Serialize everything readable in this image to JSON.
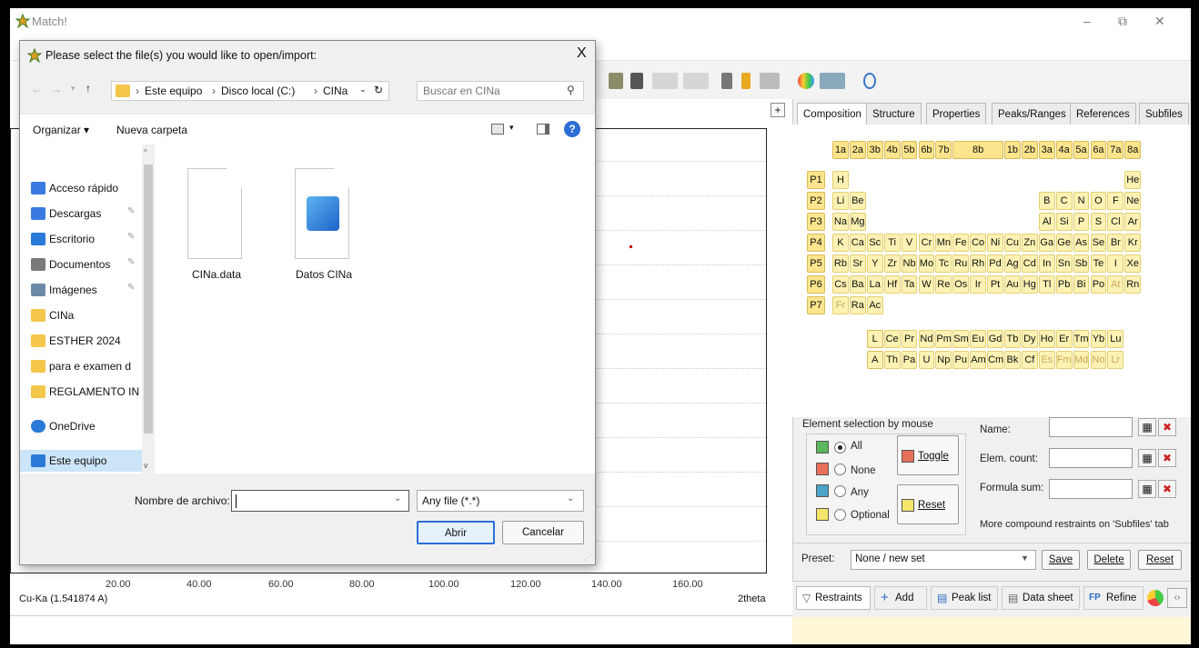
{
  "app": {
    "title": "Match!",
    "window_controls": [
      "–",
      "⧉",
      "✕"
    ]
  },
  "toolbar_icons": [
    "tool-icon",
    "stop-icon",
    "undo-icon",
    "redo-icon",
    "database-icon",
    "book-icon",
    "settings-icon",
    "color-icon",
    "chart-icon",
    "zoom-icon"
  ],
  "plot": {
    "x_ticks": [
      "20.00",
      "40.00",
      "60.00",
      "80.00",
      "100.00",
      "120.00",
      "140.00",
      "160.00"
    ],
    "wavelength_label": "Cu-Ka (1.541874 A)",
    "x_axis_label": "2theta",
    "plus_label": "+"
  },
  "right_panel": {
    "tabs": [
      "Composition",
      "Structure",
      "Properties",
      "Peaks/Ranges",
      "References",
      "Subfiles"
    ],
    "groups": [
      "1a",
      "2a",
      "3b",
      "4b",
      "5b",
      "6b",
      "7b",
      "8b",
      "1b",
      "2b",
      "3a",
      "4a",
      "5a",
      "6a",
      "7a",
      "8a"
    ],
    "periods": [
      "P1",
      "P2",
      "P3",
      "P4",
      "P5",
      "P6",
      "P7"
    ],
    "rows": [
      [
        "H",
        "",
        "",
        "",
        "",
        "",
        "",
        "",
        "",
        "",
        "",
        "",
        "",
        "",
        "",
        "",
        "",
        "He"
      ],
      [
        "Li",
        "Be",
        "",
        "",
        "",
        "",
        "",
        "",
        "",
        "",
        "",
        "",
        "B",
        "C",
        "N",
        "O",
        "F",
        "Ne"
      ],
      [
        "Na",
        "Mg",
        "",
        "",
        "",
        "",
        "",
        "",
        "",
        "",
        "",
        "",
        "Al",
        "Si",
        "P",
        "S",
        "Cl",
        "Ar"
      ],
      [
        "K",
        "Ca",
        "Sc",
        "Ti",
        "V",
        "Cr",
        "Mn",
        "Fe",
        "Co",
        "Ni",
        "Cu",
        "Zn",
        "Ga",
        "Ge",
        "As",
        "Se",
        "Br",
        "Kr"
      ],
      [
        "Rb",
        "Sr",
        "Y",
        "Zr",
        "Nb",
        "Mo",
        "Tc",
        "Ru",
        "Rh",
        "Pd",
        "Ag",
        "Cd",
        "In",
        "Sn",
        "Sb",
        "Te",
        "I",
        "Xe"
      ],
      [
        "Cs",
        "Ba",
        "La",
        "Hf",
        "Ta",
        "W",
        "Re",
        "Os",
        "Ir",
        "Pt",
        "Au",
        "Hg",
        "Tl",
        "Pb",
        "Bi",
        "Po",
        "At",
        "Rn"
      ],
      [
        "Fr",
        "Ra",
        "Ac",
        "",
        "",
        "",
        "",
        "",
        "",
        "",
        "",
        "",
        "",
        "",
        "",
        "",
        "",
        ""
      ]
    ],
    "dim_elements": [
      "At",
      "Fr",
      "Es",
      "Fm",
      "Md",
      "No",
      "Lr"
    ],
    "lanthanide_label": "L",
    "actinide_label": "A",
    "lanthanides": [
      "Ce",
      "Pr",
      "Nd",
      "Pm",
      "Sm",
      "Eu",
      "Gd",
      "Tb",
      "Dy",
      "Ho",
      "Er",
      "Tm",
      "Yb",
      "Lu"
    ],
    "actinides": [
      "Th",
      "Pa",
      "U",
      "Np",
      "Pu",
      "Am",
      "Cm",
      "Bk",
      "Cf",
      "Es",
      "Fm",
      "Md",
      "No",
      "Lr"
    ],
    "selection": {
      "heading": "Element selection by mouse",
      "options": [
        {
          "label": "All",
          "color": "#5cb85c",
          "checked": true
        },
        {
          "label": "None",
          "color": "#e8705a",
          "checked": false
        },
        {
          "label": "Any",
          "color": "#4aa3c8",
          "checked": false
        },
        {
          "label": "Optional",
          "color": "#f5e66a",
          "checked": false
        }
      ],
      "toggle_label": "Toggle",
      "reset_label": "Reset"
    },
    "fields": {
      "name_label": "Name:",
      "count_label": "Elem. count:",
      "formula_label": "Formula sum:"
    },
    "more_text": "More compound restraints on 'Subfiles' tab",
    "preset": {
      "label": "Preset:",
      "value": "None / new set",
      "save": "Save",
      "delete": "Delete",
      "reset": "Reset"
    },
    "bottom_tabs": [
      "Restraints",
      "Add",
      "Peak list",
      "Data sheet",
      "Refine"
    ]
  },
  "dialog": {
    "title": "Please select the file(s) you would like to open/import:",
    "close": "X",
    "breadcrumb": [
      "Este equipo",
      "Disco local (C:)",
      "CINa"
    ],
    "search_placeholder": "Buscar en CINa",
    "organize": "Organizar ▾",
    "new_folder": "Nueva carpeta",
    "tree": [
      {
        "label": "Acceso rápido",
        "icon": "star-icon",
        "pinned": false
      },
      {
        "label": "Descargas",
        "icon": "download-icon",
        "pinned": true
      },
      {
        "label": "Escritorio",
        "icon": "desktop-icon",
        "pinned": true
      },
      {
        "label": "Documentos",
        "icon": "document-icon",
        "pinned": true
      },
      {
        "label": "Imágenes",
        "icon": "image-icon",
        "pinned": true
      },
      {
        "label": "CINa",
        "icon": "folder-icon",
        "pinned": false
      },
      {
        "label": "ESTHER 2024",
        "icon": "folder-icon",
        "pinned": false
      },
      {
        "label": "para e examen d",
        "icon": "folder-icon",
        "pinned": false
      },
      {
        "label": "REGLAMENTO IN",
        "icon": "folder-icon",
        "pinned": false
      },
      {
        "label": "OneDrive",
        "icon": "cloud-icon",
        "pinned": false
      },
      {
        "label": "Este equipo",
        "icon": "computer-icon",
        "pinned": false
      }
    ],
    "files": [
      {
        "name": "CINa.data",
        "icon": "blank-file-icon"
      },
      {
        "name": "Datos CINa",
        "icon": "image-file-icon"
      }
    ],
    "filename_label": "Nombre de archivo:",
    "filename_value": "",
    "filetype": "Any file (*.*)",
    "open": "Abrir",
    "cancel": "Cancelar"
  }
}
